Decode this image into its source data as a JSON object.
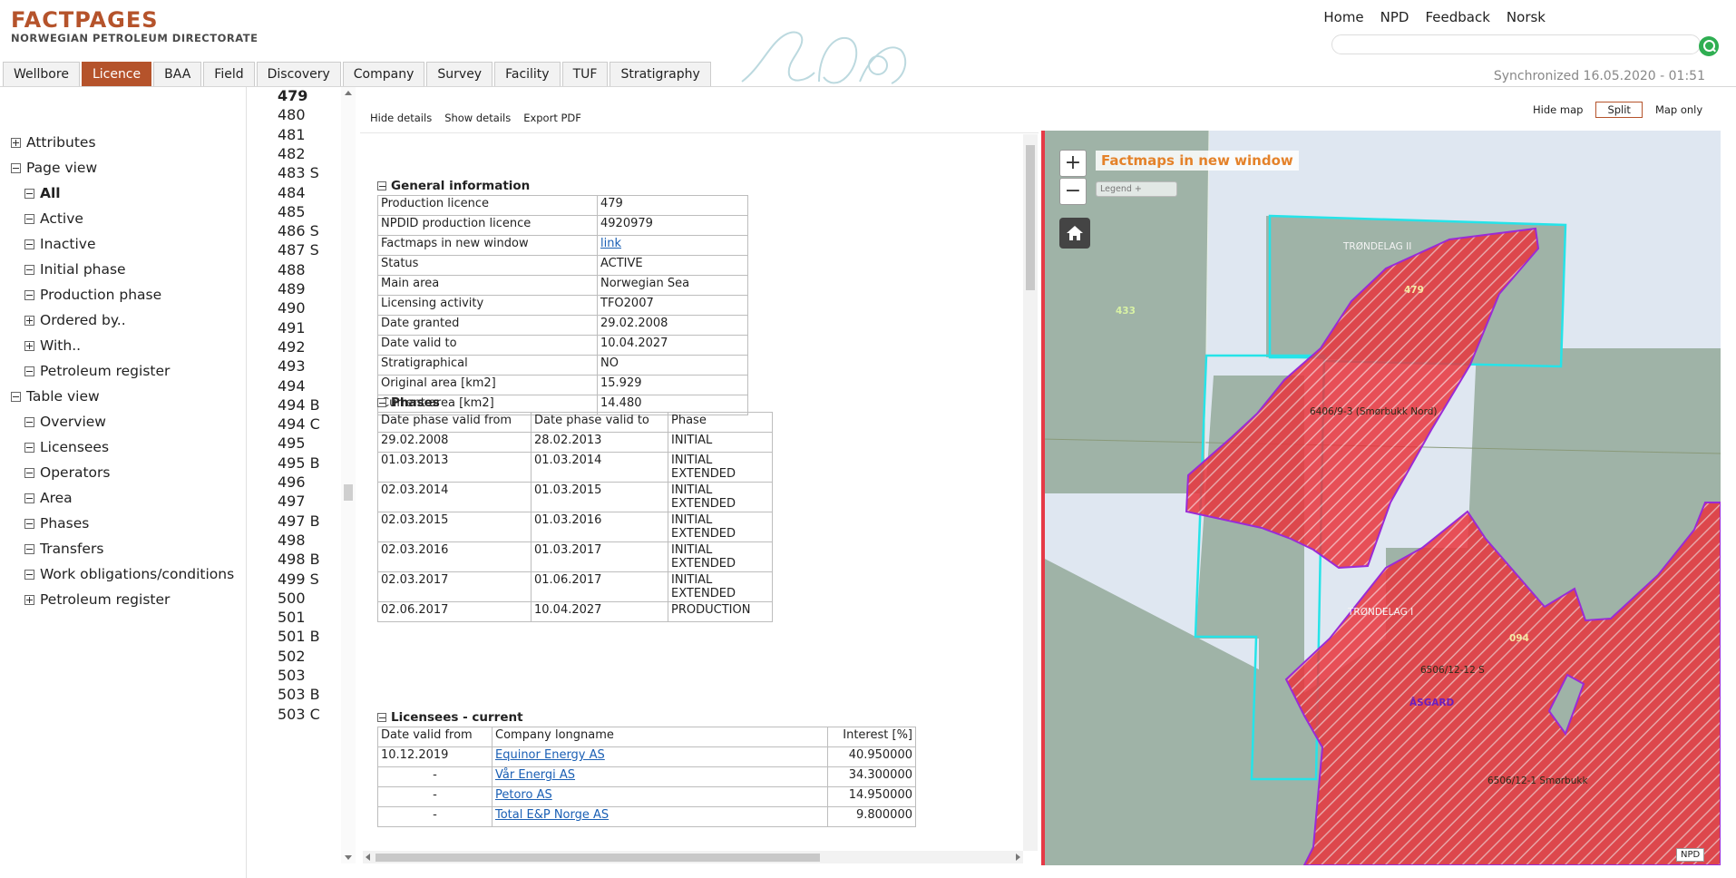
{
  "header": {
    "logo_title": "FACTPAGES",
    "logo_subtitle": "NORWEGIAN PETROLEUM DIRECTORATE",
    "links": [
      "Home",
      "NPD",
      "Feedback",
      "Norsk"
    ],
    "sync_text": "Synchronized 16.05.2020 - 01:51",
    "tabs": [
      "Wellbore",
      "Licence",
      "BAA",
      "Field",
      "Discovery",
      "Company",
      "Survey",
      "Facility",
      "TUF",
      "Stratigraphy"
    ],
    "active_tab": "Licence"
  },
  "tree": {
    "items": [
      {
        "label": "Attributes",
        "level": 1,
        "icon": "plus"
      },
      {
        "label": "Page view",
        "level": 1,
        "icon": "minus"
      },
      {
        "label": "All",
        "level": 2,
        "icon": "minus",
        "bold": true
      },
      {
        "label": "Active",
        "level": 2,
        "icon": "minus"
      },
      {
        "label": "Inactive",
        "level": 2,
        "icon": "minus"
      },
      {
        "label": "Initial phase",
        "level": 2,
        "icon": "minus"
      },
      {
        "label": "Production phase",
        "level": 2,
        "icon": "minus"
      },
      {
        "label": "Ordered by..",
        "level": 2,
        "icon": "plus"
      },
      {
        "label": "With..",
        "level": 2,
        "icon": "plus"
      },
      {
        "label": "Petroleum register",
        "level": 2,
        "icon": "minus"
      },
      {
        "label": "Table view",
        "level": 1,
        "icon": "minus"
      },
      {
        "label": "Overview",
        "level": 2,
        "icon": "minus"
      },
      {
        "label": "Licensees",
        "level": 2,
        "icon": "minus"
      },
      {
        "label": "Operators",
        "level": 2,
        "icon": "minus"
      },
      {
        "label": "Area",
        "level": 2,
        "icon": "minus"
      },
      {
        "label": "Phases",
        "level": 2,
        "icon": "minus"
      },
      {
        "label": "Transfers",
        "level": 2,
        "icon": "minus"
      },
      {
        "label": "Work obligations/conditions",
        "level": 2,
        "icon": "minus"
      },
      {
        "label": "Petroleum register",
        "level": 2,
        "icon": "plus"
      }
    ]
  },
  "licence_list": {
    "selected": "479",
    "items": [
      "479",
      "480",
      "481",
      "482",
      "483 S",
      "484",
      "485",
      "486 S",
      "487 S",
      "488",
      "489",
      "490",
      "491",
      "492",
      "493",
      "494",
      "494 B",
      "494 C",
      "495",
      "495 B",
      "496",
      "497",
      "497 B",
      "498",
      "498 B",
      "499 S",
      "500",
      "501",
      "501 B",
      "502",
      "503",
      "503 B",
      "503 C"
    ]
  },
  "toolbar": {
    "hide_details": "Hide details",
    "show_details": "Show details",
    "export_pdf": "Export PDF"
  },
  "general": {
    "title": "General information",
    "rows": [
      {
        "label": "Production licence",
        "value": "479"
      },
      {
        "label": "NPDID production licence",
        "value": "4920979"
      },
      {
        "label": "Factmaps in new window",
        "value": "link",
        "is_link": true
      },
      {
        "label": "Status",
        "value": "ACTIVE"
      },
      {
        "label": "Main area",
        "value": "Norwegian Sea"
      },
      {
        "label": "Licensing activity",
        "value": "TFO2007"
      },
      {
        "label": "Date granted",
        "value": "29.02.2008"
      },
      {
        "label": "Date valid to",
        "value": "10.04.2027"
      },
      {
        "label": "Stratigraphical",
        "value": "NO"
      },
      {
        "label": "Original area [km2]",
        "value": "15.929"
      },
      {
        "label": "Current area [km2]",
        "value": "14.480"
      }
    ]
  },
  "phases": {
    "title": "Phases",
    "headers": [
      "Date phase valid from",
      "Date phase valid to",
      "Phase"
    ],
    "rows": [
      [
        "29.02.2008",
        "28.02.2013",
        "INITIAL"
      ],
      [
        "01.03.2013",
        "01.03.2014",
        "INITIAL EXTENDED"
      ],
      [
        "02.03.2014",
        "01.03.2015",
        "INITIAL EXTENDED"
      ],
      [
        "02.03.2015",
        "01.03.2016",
        "INITIAL EXTENDED"
      ],
      [
        "02.03.2016",
        "01.03.2017",
        "INITIAL EXTENDED"
      ],
      [
        "02.03.2017",
        "01.06.2017",
        "INITIAL EXTENDED"
      ],
      [
        "02.06.2017",
        "10.04.2027",
        "PRODUCTION"
      ]
    ]
  },
  "licensees": {
    "title": "Licensees - current",
    "headers": [
      "Date valid from",
      "Company longname",
      "Interest [%]"
    ],
    "rows": [
      [
        "10.12.2019",
        "Equinor Energy AS",
        "40.950000"
      ],
      [
        "-",
        "Vår Energi AS",
        "34.300000"
      ],
      [
        "-",
        "Petoro AS",
        "14.950000"
      ],
      [
        "-",
        "Total E&P Norge AS",
        "9.800000"
      ]
    ]
  },
  "map": {
    "controls": {
      "hide_map": "Hide map",
      "split": "Split",
      "map_only": "Map only"
    },
    "title": "Factmaps in new window",
    "legend": "Legend +",
    "attribution": "NPD",
    "labels": [
      "TRØNDELAG II",
      "479",
      "433",
      "6406/9-3 (Smørbukk Nord)",
      "TRØNDELAG I",
      "094",
      "6506/12-12 S",
      "ÅSGARD",
      "6506/12-1 Smørbukk"
    ],
    "colors": {
      "licence_fill": "#e8343c",
      "block_fill": "#9fb3a7",
      "block_outline": "#26e3e8",
      "licence_outline": "#9a2bd6",
      "sea": "#dfe7f1"
    }
  }
}
